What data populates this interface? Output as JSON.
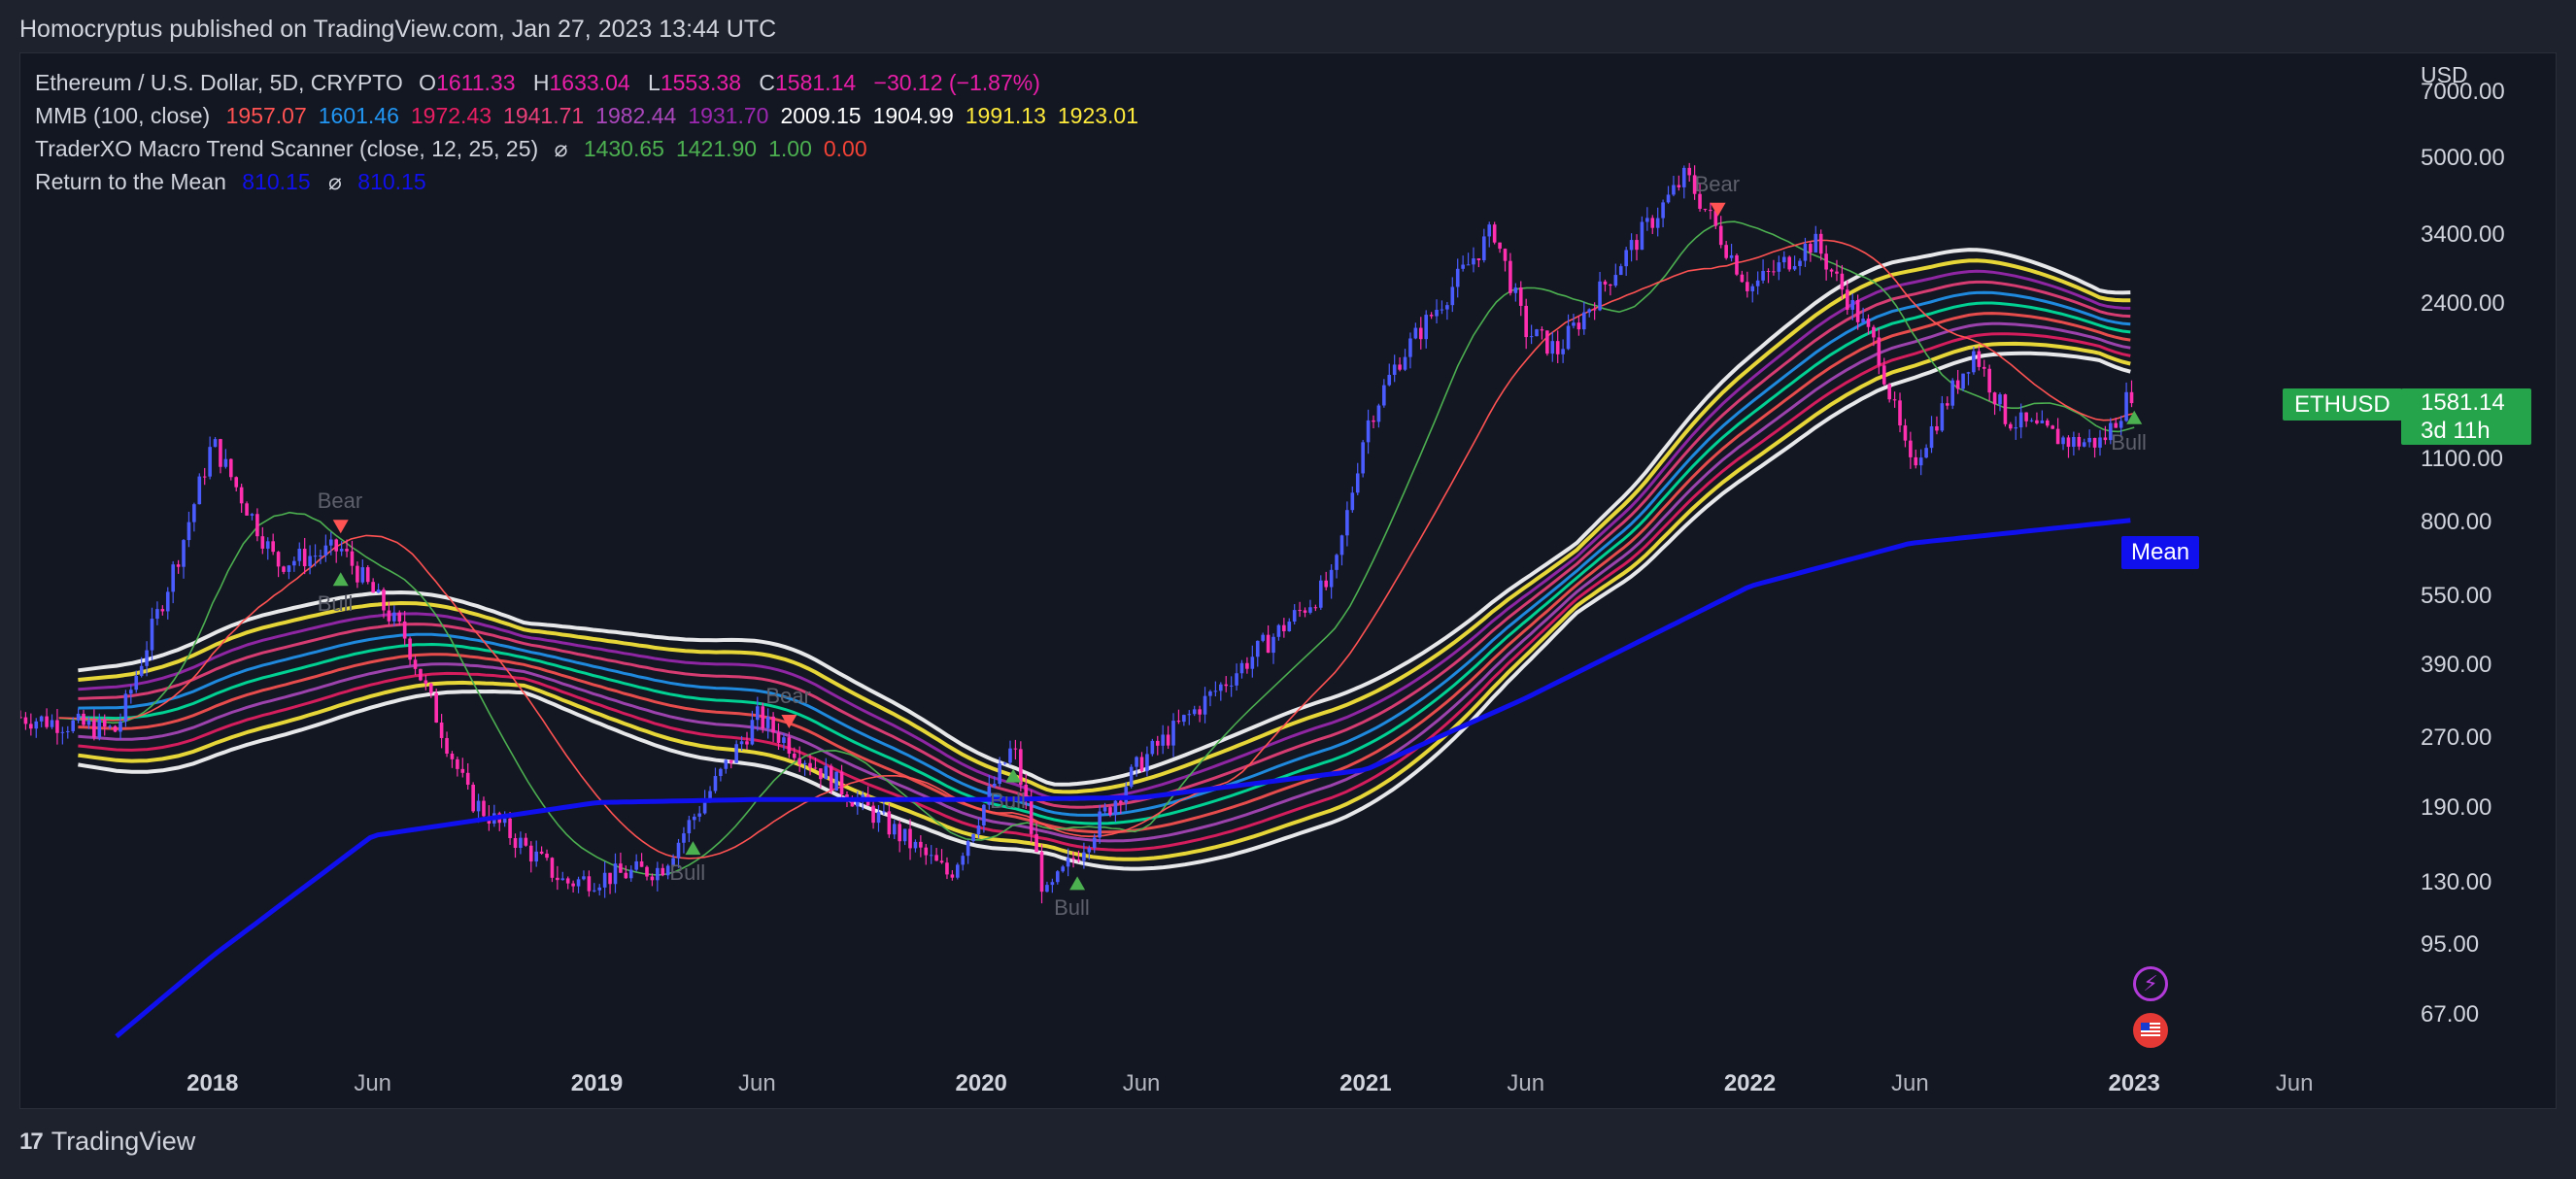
{
  "header": {
    "published": "Homocryptus published on TradingView.com, Jan 27, 2023 13:44 UTC"
  },
  "footer": {
    "brand": "TradingView",
    "logo_icon": "tradingview-logo-icon"
  },
  "legend": {
    "symbol": {
      "label": "Ethereum / U.S. Dollar, 5D, CRYPTO",
      "open_label": "O",
      "open": "1611.33",
      "high_label": "H",
      "high": "1633.04",
      "low_label": "L",
      "low": "1553.38",
      "close_label": "C",
      "close": "1581.14",
      "change": "−30.12 (−1.87%)"
    },
    "mmb": {
      "label": "MMB (100, close)",
      "values": [
        "1957.07",
        "1601.46",
        "1972.43",
        "1941.71",
        "1982.44",
        "1931.70",
        "2009.15",
        "1904.99",
        "1991.13",
        "1923.01"
      ],
      "colors": [
        "#ff5252",
        "#2196f3",
        "#e91e63",
        "#ec407a",
        "#ab47bc",
        "#9c27b0",
        "#ffffff",
        "#ffffff",
        "#ffeb3b",
        "#ffeb3b"
      ]
    },
    "macro": {
      "label": "TraderXO Macro Trend Scanner (close, 12, 25, 25)",
      "symbol": "⌀",
      "values": [
        "1430.65",
        "1421.90",
        "1.00",
        "0.00"
      ],
      "colors": [
        "#4caf50",
        "#4caf50",
        "#4caf50",
        "#f44336"
      ]
    },
    "mean": {
      "label": "Return to the Mean",
      "values": [
        "810.15",
        "810.15"
      ],
      "symbol": "⌀",
      "color": "#1010ee"
    }
  },
  "price_scale": {
    "currency": "USD",
    "ticks": [
      "7000.00",
      "5000.00",
      "3400.00",
      "2400.00",
      "1100.00",
      "800.00",
      "550.00",
      "390.00",
      "270.00",
      "190.00",
      "130.00",
      "95.00",
      "67.00"
    ]
  },
  "time_scale": {
    "ticks": [
      {
        "label": "2018",
        "year": true
      },
      {
        "label": "Jun",
        "year": false
      },
      {
        "label": "2019",
        "year": true
      },
      {
        "label": "Jun",
        "year": false
      },
      {
        "label": "2020",
        "year": true
      },
      {
        "label": "Jun",
        "year": false
      },
      {
        "label": "2021",
        "year": true
      },
      {
        "label": "Jun",
        "year": false
      },
      {
        "label": "2022",
        "year": true
      },
      {
        "label": "Jun",
        "year": false
      },
      {
        "label": "2023",
        "year": true
      },
      {
        "label": "Jun",
        "year": false
      }
    ]
  },
  "tags": {
    "symbol": "ETHUSD",
    "price": "1581.14",
    "countdown": "3d 11h",
    "mean": "Mean"
  },
  "chart_data": {
    "type": "line",
    "title": "Ethereum / U.S. Dollar, 5D, CRYPTO",
    "xlabel": "",
    "ylabel": "USD",
    "y_scale": "log",
    "ylim": [
      55,
      8500
    ],
    "xlim": [
      "2017-07",
      "2023-09"
    ],
    "series": [
      {
        "name": "ETHUSD",
        "color": "#e91ea8",
        "x": [
          "2017-07",
          "2017-10",
          "2017-12",
          "2018-01",
          "2018-03",
          "2018-05",
          "2018-07",
          "2018-09",
          "2018-12",
          "2019-03",
          "2019-06",
          "2019-09",
          "2019-12",
          "2020-02",
          "2020-03",
          "2020-06",
          "2020-09",
          "2020-12",
          "2021-01",
          "2021-02",
          "2021-04",
          "2021-05",
          "2021-06",
          "2021-07",
          "2021-09",
          "2021-11",
          "2022-01",
          "2022-03",
          "2022-05",
          "2022-06",
          "2022-08",
          "2022-09",
          "2022-11",
          "2022-12",
          "2023-01"
        ],
        "y": [
          300,
          280,
          700,
          1200,
          650,
          700,
          450,
          200,
          130,
          140,
          300,
          200,
          135,
          260,
          120,
          240,
          380,
          600,
          1300,
          1800,
          2800,
          3500,
          2100,
          1900,
          3000,
          4600,
          2600,
          3300,
          1900,
          1050,
          1900,
          1350,
          1200,
          1200,
          1581
        ]
      },
      {
        "name": "Mean",
        "color": "#1010ee",
        "x": [
          "2017-10",
          "2018-01",
          "2018-06",
          "2019-01",
          "2019-06",
          "2020-01",
          "2020-06",
          "2021-01",
          "2021-06",
          "2022-01",
          "2022-06",
          "2023-01"
        ],
        "y": [
          60,
          90,
          165,
          195,
          198,
          198,
          200,
          230,
          330,
          580,
          720,
          810
        ]
      }
    ],
    "annotations": [
      {
        "label": "Bear",
        "x": "2018-05"
      },
      {
        "label": "Bull",
        "x": "2018-05"
      },
      {
        "label": "Bull",
        "x": "2019-04"
      },
      {
        "label": "Bear",
        "x": "2019-07"
      },
      {
        "label": "Bull",
        "x": "2020-02"
      },
      {
        "label": "Bull",
        "x": "2020-04"
      },
      {
        "label": "Bear",
        "x": "2021-12"
      },
      {
        "label": "Bull",
        "x": "2023-01"
      }
    ]
  }
}
